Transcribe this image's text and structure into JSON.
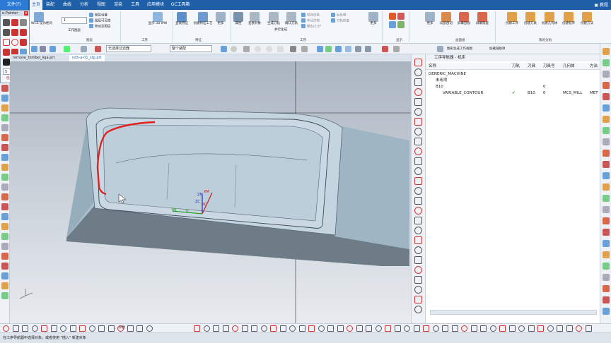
{
  "menu": {
    "file_label": "文件(F)",
    "tabs": [
      "主页",
      "装配",
      "曲线",
      "分析",
      "视图",
      "渲染",
      "工具",
      "应用模块",
      "GC工具箱"
    ],
    "active_tab": 0,
    "right_label": "教程"
  },
  "epointer": {
    "title": "e-Pointer",
    "number_value": "5",
    "hint": "使用方法"
  },
  "ribbon": {
    "wcs_label": "WCS 设为绝对",
    "spin_value": "1",
    "sm1": [
      "图层设置",
      "图层可见性",
      "移动至图层"
    ],
    "worklayer_label": "工作图层",
    "display_3d_label": "显示 3D IPW",
    "find_feature_label": "查找特征",
    "create_feature_label": "创建特征工艺",
    "more_label": "更多",
    "attr_label": "属性",
    "transform_label": "变换对象",
    "gen_toolpath_label": "生成刀轨",
    "sim_toolpath_label": "确认刀轨",
    "sm2": [
      "机床仿真",
      "车间文档",
      "输出CLSF"
    ],
    "post_label": "后处理",
    "sm3": [
      "后处理",
      "刀轨检查"
    ],
    "parallel_label": "并行生成",
    "more2_label": "更多",
    "more3_label": "更多",
    "halfview_label": "局部剖切",
    "bbox_view_label": "屏幕剖视",
    "screen_angle_label": "屏幕角度",
    "create_tool_label": "创建工序",
    "create_tool2_label": "创建刀具",
    "create_geom_label": "创建几何体",
    "create_prog_label": "创建程序",
    "create_method_label": "创建方法",
    "group_labels": [
      "图层",
      "工序",
      "特征",
      "工序",
      "显示",
      "刷新",
      "画面组",
      "刀片",
      "我的分组"
    ]
  },
  "toolbar2": {
    "filter_value": "无选择过滤器",
    "scope_value": "整个装配",
    "label1": "图形生成工作视图",
    "label2": "加载辅助项"
  },
  "doc_tabs": [
    "remove_tbmbel_liga.prt",
    "ndh-a-01_stp.prt"
  ],
  "active_doc_tab": 1,
  "navigator": {
    "title": "工序导航器 - 机床",
    "columns": [
      "名称",
      "刀轨",
      "刀具",
      "刀具号",
      "几何体",
      "方法"
    ],
    "rows": [
      {
        "name": "GENERIC_MACHINE",
        "path": "",
        "tool": "",
        "toolno": "",
        "geom": "",
        "method": "",
        "indent": 0
      },
      {
        "name": "未用项",
        "path": "",
        "tool": "",
        "toolno": "",
        "geom": "",
        "method": "",
        "indent": 1
      },
      {
        "name": "B10",
        "path": "",
        "tool": "",
        "toolno": "0",
        "geom": "",
        "method": "",
        "indent": 1
      },
      {
        "name": "VARIABLE_CONTOUR",
        "path": "✔",
        "tool": "B10",
        "toolno": "0",
        "geom": "MCS_MILL",
        "method": "MET",
        "indent": 2
      }
    ]
  },
  "viewport": {
    "axis_labels": [
      "XM",
      "ZM",
      "YM",
      "YC",
      "ZC",
      "XC"
    ]
  },
  "bottom": {
    "params_label": "参数",
    "status_text": "在工序导航器中选择对象，或者使用 \"插入\" 新建对象"
  },
  "colors": {
    "accent": "#1f5fa8",
    "part": "#b9ccd8",
    "part_dark": "#5d6a76",
    "toolpath": "#e02020"
  }
}
